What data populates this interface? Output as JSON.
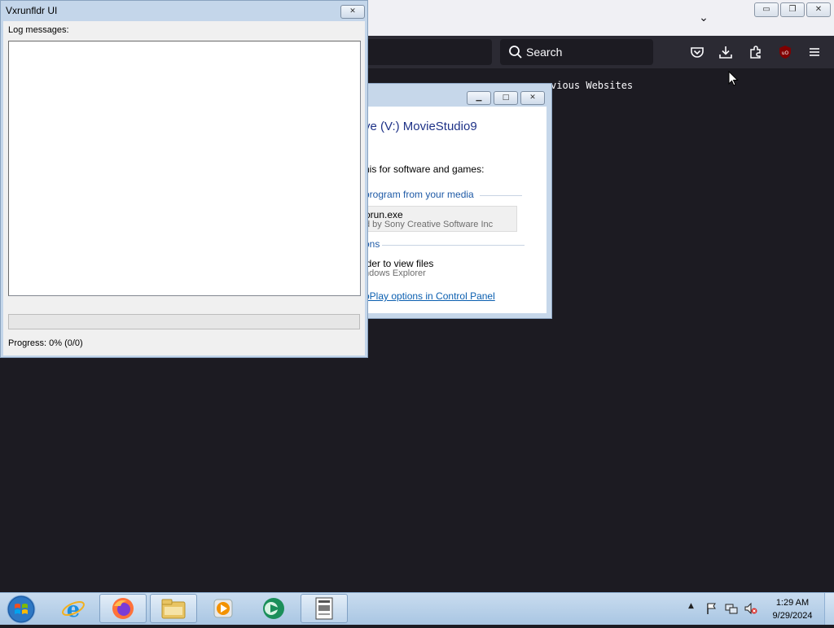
{
  "firefox": {
    "search": {
      "placeholder": "Search"
    },
    "content_text": "vious Websites",
    "toolbar_icons": [
      "pocket-icon",
      "downloads-icon",
      "extensions-icon",
      "ublock-icon",
      "menu-icon"
    ],
    "caption_buttons": {
      "minimize": "▭",
      "restore": "❐",
      "close": "✕"
    },
    "tab_list_glyph": "⌄",
    "colors": {
      "toolbar": "#2b2a33",
      "content": "#1c1b22",
      "titlebar": "#f0f0f4"
    }
  },
  "autoplay": {
    "heading": "ve (V:) MovieStudio9",
    "sub": "his for software and games:",
    "section_install": "program from your media",
    "option_run_title": "orun.exe",
    "option_run_desc": "d by Sony Creative Software Inc",
    "section_general": "ons",
    "option_open_title": "lder to view files",
    "option_open_desc": "ndows Explorer",
    "link": "oPlay options in Control Panel",
    "buttons": {
      "minimize": "▁",
      "maximize": "□",
      "close": "✕"
    }
  },
  "vxrunfldr": {
    "title": "Vxrunfldr UI",
    "close": "✕",
    "log_label": "Log messages:",
    "progress_value": 0,
    "progress_text": "Progress: 0% (0/0)"
  },
  "taskbar": {
    "items": [
      "internet-explorer-icon",
      "firefox-icon",
      "explorer-icon",
      "media-player-icon",
      "app-icon",
      "document-icon"
    ],
    "tray_expand": "▲",
    "clock": {
      "time": "1:29 AM",
      "date": "9/29/2024"
    }
  }
}
